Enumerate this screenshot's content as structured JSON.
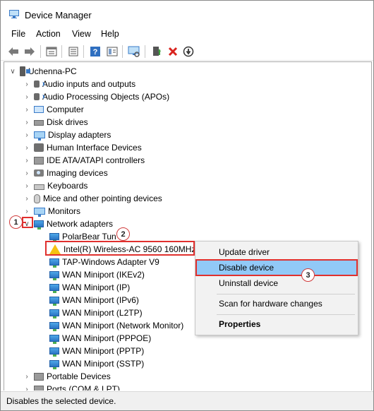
{
  "window": {
    "title": "Device Manager"
  },
  "menu": [
    "File",
    "Action",
    "View",
    "Help"
  ],
  "toolbar": {
    "icons": [
      "back-arrow-icon",
      "forward-arrow-icon",
      "properties-icon",
      "show-hidden-icon",
      "help-icon",
      "view-icon",
      "scan-monitor-icon",
      "update-driver-icon",
      "uninstall-icon",
      "disable-icon"
    ]
  },
  "tree": {
    "root": "Uchenna-PC",
    "categories": [
      "Audio inputs and outputs",
      "Audio Processing Objects (APOs)",
      "Computer",
      "Disk drives",
      "Display adapters",
      "Human Interface Devices",
      "IDE ATA/ATAPI controllers",
      "Imaging devices",
      "Keyboards",
      "Mice and other pointing devices",
      "Monitors",
      "Network adapters"
    ],
    "network_children": [
      "PolarBear Tun",
      "Intel(R) Wireless-AC 9560 160MHz",
      "TAP-Windows Adapter V9",
      "WAN Miniport (IKEv2)",
      "WAN Miniport (IP)",
      "WAN Miniport (IPv6)",
      "WAN Miniport (L2TP)",
      "WAN Miniport (Network Monitor)",
      "WAN Miniport (PPPOE)",
      "WAN Miniport (PPTP)",
      "WAN Miniport (SSTP)"
    ],
    "after": [
      "Portable Devices",
      "Ports (COM & LPT)"
    ]
  },
  "context_menu": {
    "items": [
      "Update driver",
      "Disable device",
      "Uninstall device",
      "Scan for hardware changes",
      "Properties"
    ],
    "highlighted": "Disable device"
  },
  "annotations": {
    "badge1": "1",
    "badge2": "2",
    "badge3": "3"
  },
  "colors": {
    "highlight": "#91c9f7",
    "annotation_red": "#e0302e",
    "status_bg": "#f0f0f0"
  },
  "status": {
    "text": "Disables the selected device."
  }
}
